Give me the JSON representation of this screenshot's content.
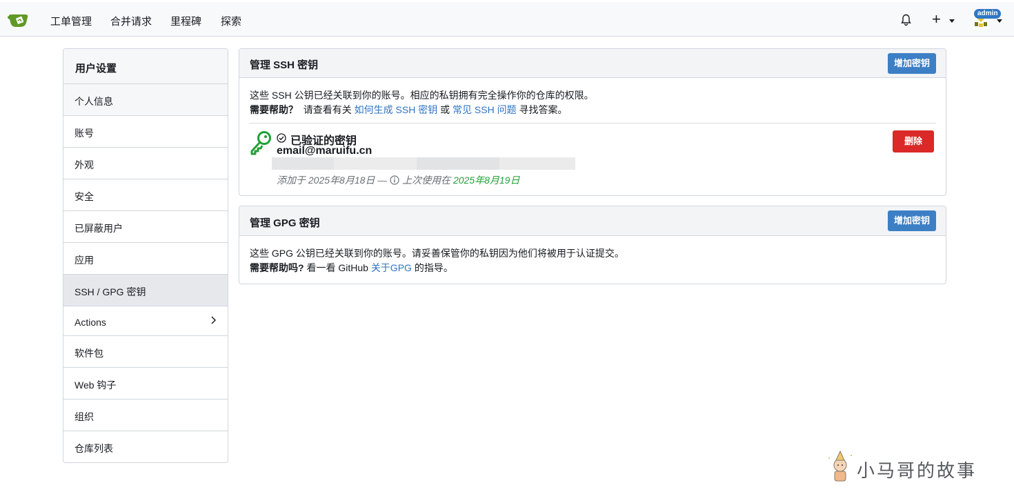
{
  "nav": {
    "items": [
      "工单管理",
      "合并请求",
      "里程碑",
      "探索"
    ],
    "admin_badge": "admin"
  },
  "sidebar": {
    "title": "用户设置",
    "items": [
      {
        "label": "个人信息"
      },
      {
        "label": "账号"
      },
      {
        "label": "外观"
      },
      {
        "label": "安全"
      },
      {
        "label": "已屏蔽用户"
      },
      {
        "label": "应用"
      },
      {
        "label": "SSH / GPG 密钥",
        "active": true
      },
      {
        "label": "Actions"
      },
      {
        "label": "软件包"
      },
      {
        "label": "Web 钩子"
      },
      {
        "label": "组织"
      },
      {
        "label": "仓库列表"
      }
    ]
  },
  "ssh": {
    "title": "管理 SSH 密钥",
    "add_button": "增加密钥",
    "desc": "这些 SSH 公钥已经关联到你的账号。相应的私钥拥有完全操作你的仓库的权限。",
    "help_label": "需要帮助？",
    "help_prefix": "请查看有关",
    "help_link1": "如何生成 SSH 密钥",
    "help_or": "或",
    "help_link2": "常见 SSH 问题",
    "help_suffix": "寻找答案。",
    "key": {
      "verified_label": "已验证的密钥",
      "name": "email@maruifu.cn",
      "added": "添加于 2025年8月18日 —",
      "last_used_label": "上次使用在",
      "last_used": "2025年8月19日",
      "delete_button": "删除"
    }
  },
  "gpg": {
    "title": "管理 GPG 密钥",
    "add_button": "增加密钥",
    "desc": "这些 GPG 公钥已经关联到你的账号。请妥善保管你的私钥因为他们将被用于认证提交。",
    "help_label": "需要帮助吗?",
    "help_prefix": "看一看 GitHub",
    "help_link": "关于GPG",
    "help_suffix": "的指导。"
  },
  "watermark": "小马哥的故事",
  "colors": {
    "primary": "#3d7fc5",
    "danger": "#db2828",
    "success": "#21a038",
    "link": "#2f73c2"
  }
}
